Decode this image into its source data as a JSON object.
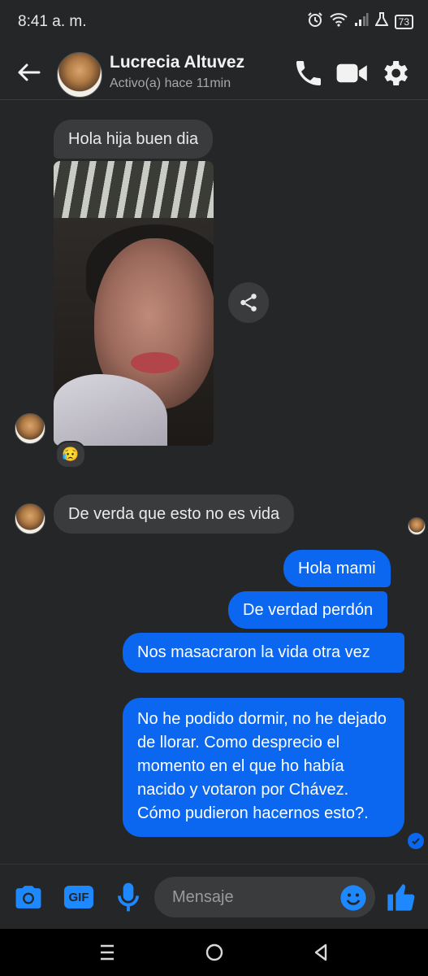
{
  "status_bar": {
    "time": "8:41 a. m.",
    "battery": "73",
    "icons": [
      "alarm-icon",
      "wifi-icon",
      "signal-icon",
      "lab-icon",
      "battery-icon"
    ]
  },
  "header": {
    "contact_name": "Lucrecia Altuvez",
    "contact_status": "Activo(a) hace 11min",
    "icons": [
      "back-arrow-icon",
      "phone-icon",
      "video-camera-icon",
      "gear-icon"
    ]
  },
  "messages": {
    "incoming_1": "Hola hija buen dia",
    "reaction": "😥",
    "incoming_2": "De verda que esto no es vida",
    "outgoing_1": "Hola mami",
    "outgoing_2": "De verdad perdón",
    "outgoing_3": "Nos masacraron la vida otra vez",
    "outgoing_4": "No he podido dormir, no he dejado de llorar. Como desprecio el momento en el que ho había nacido y votaron por Chávez. Cómo pudieron hacernos esto?."
  },
  "composer": {
    "placeholder": "Mensaje",
    "gif_label": "GIF",
    "icons": [
      "camera-icon",
      "gif-icon",
      "microphone-icon",
      "emoji-icon",
      "thumbs-up-icon"
    ]
  },
  "nav_bar": {
    "icons": [
      "recent-apps-icon",
      "home-icon",
      "back-icon"
    ]
  },
  "colors": {
    "background": "#252628",
    "incoming_bubble": "#3a3b3d",
    "outgoing_bubble": "#0b67ef",
    "accent": "#1e88ff"
  }
}
